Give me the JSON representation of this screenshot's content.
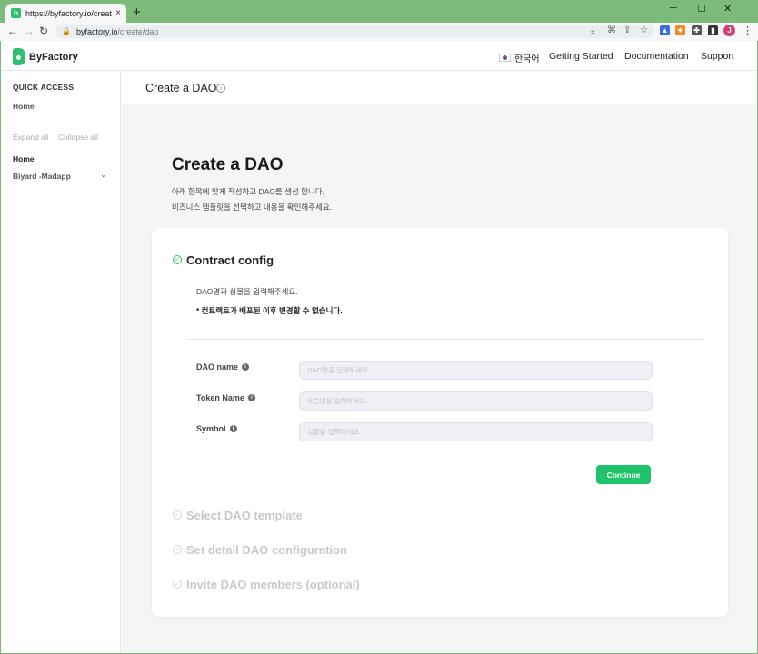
{
  "browser": {
    "tab_title": "https://byfactory.io/create/dao",
    "url_host": "byfactory.io",
    "url_path": "/create/dao",
    "new_tab": "+",
    "tab_close": "×",
    "minimize": "─",
    "maximize": "☐",
    "close": "✕",
    "back": "←",
    "forward": "→",
    "reload": "↻",
    "lock": "🔒",
    "profile_initial": "J",
    "accent_color": "#7dbb7b"
  },
  "header": {
    "logo_text": "ByFactory",
    "language": "한국어",
    "nav": [
      "Getting Started",
      "Documentation",
      "Support"
    ],
    "brand_color": "#2fbf71"
  },
  "sidebar": {
    "quick_access": "QUICK ACCESS",
    "home_link": "Home",
    "expand_all": "Expand all",
    "collapse_all": "Collapse all",
    "items": [
      {
        "label": "Home"
      },
      {
        "label": "Biyard -Madapp"
      }
    ]
  },
  "breadcrumb": {
    "title": "Create a DAO",
    "info": "i"
  },
  "main": {
    "heading": "Create a DAO",
    "subtitle_line1": "아래 항목에 맞게 작성하고 DAO를 생성 합니다.",
    "subtitle_line2": "비즈니스 템플릿을 선택하고 내용을 확인해주세요."
  },
  "steps": [
    {
      "title": "Contract config",
      "state": "active"
    },
    {
      "title": "Select DAO template",
      "state": "inactive"
    },
    {
      "title": "Set detail DAO configuration",
      "state": "inactive"
    },
    {
      "title": "Invite DAO members (optional)",
      "state": "inactive"
    }
  ],
  "contract_config": {
    "description": "DAO명과 심볼을 입력해주세요.",
    "warning": "* 컨트랙트가 배포된 이후 변경할 수 없습니다.",
    "fields": [
      {
        "label": "DAO name",
        "placeholder": "DAO명을 입력하세요.",
        "value": ""
      },
      {
        "label": "Token Name",
        "placeholder": "토큰명을 입력하세요.",
        "value": ""
      },
      {
        "label": "Symbol",
        "placeholder": "심볼을 입력하세요.",
        "value": ""
      }
    ],
    "continue_label": "Continue",
    "button_color": "#1fc46a"
  }
}
